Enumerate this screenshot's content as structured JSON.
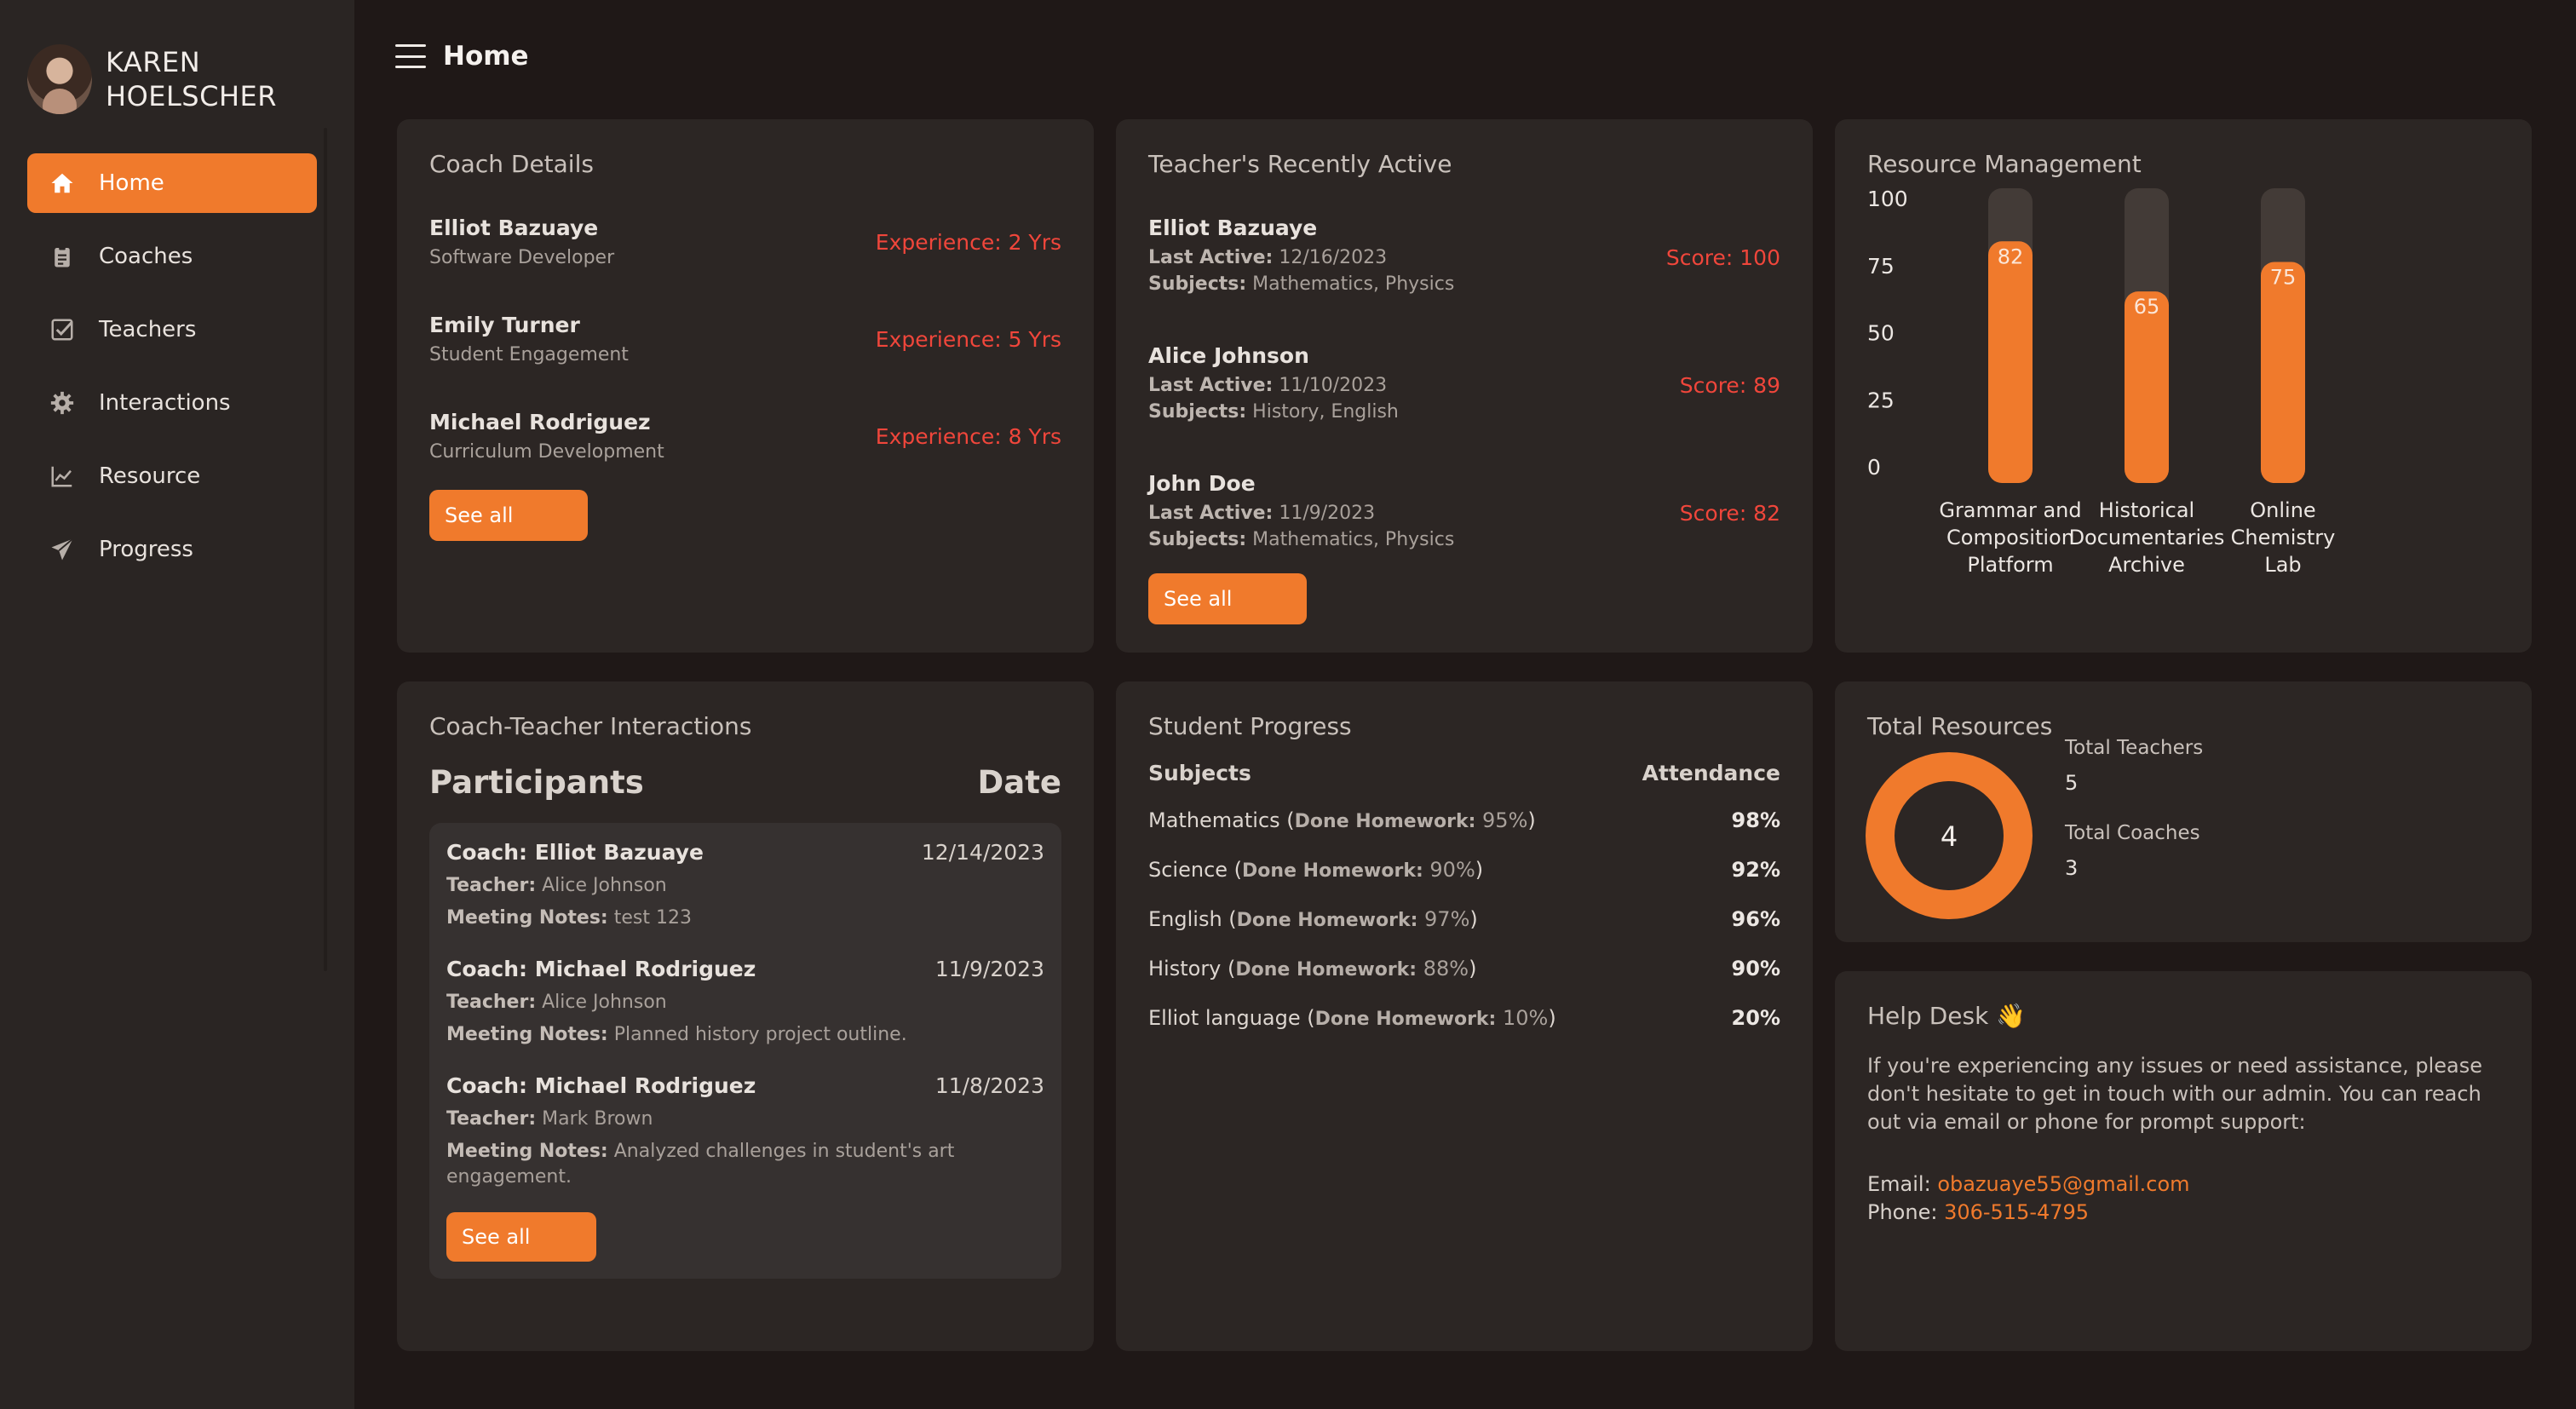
{
  "sidebar": {
    "user_name": "KAREN HOELSCHER",
    "items": [
      {
        "label": "Home",
        "icon": "home-icon"
      },
      {
        "label": "Coaches",
        "icon": "clipboard-icon"
      },
      {
        "label": "Teachers",
        "icon": "checkbox-icon"
      },
      {
        "label": "Interactions",
        "icon": "gear-icon"
      },
      {
        "label": "Resource",
        "icon": "line-chart-icon"
      },
      {
        "label": "Progress",
        "icon": "paper-plane-icon"
      }
    ]
  },
  "header": {
    "title": "Home"
  },
  "coach_details": {
    "title": "Coach Details",
    "coaches": [
      {
        "name": "Elliot Bazuaye",
        "role": "Software Developer",
        "experience": "Experience: 2 Yrs"
      },
      {
        "name": "Emily Turner",
        "role": "Student Engagement",
        "experience": "Experience: 5 Yrs"
      },
      {
        "name": "Michael Rodriguez",
        "role": "Curriculum Development",
        "experience": "Experience: 8 Yrs"
      }
    ],
    "button": "See all"
  },
  "teachers_active": {
    "title": "Teacher's Recently Active",
    "last_active_label": "Last Active:",
    "subjects_label": "Subjects:",
    "teachers": [
      {
        "name": "Elliot Bazuaye",
        "last_active": "12/16/2023",
        "subjects": "Mathematics, Physics",
        "score": "Score: 100"
      },
      {
        "name": "Alice Johnson",
        "last_active": "11/10/2023",
        "subjects": "History, English",
        "score": "Score: 89"
      },
      {
        "name": "John Doe",
        "last_active": "11/9/2023",
        "subjects": "Mathematics, Physics",
        "score": "Score: 82"
      }
    ],
    "button": "See all"
  },
  "resource_management": {
    "title": "Resource Management"
  },
  "chart_data": {
    "type": "bar",
    "categories": [
      "Grammar and Composition Platform",
      "Historical Documentaries Archive",
      "Online Chemistry Lab"
    ],
    "category_lines": [
      [
        "Grammar and",
        "Composition",
        "Platform"
      ],
      [
        "Historical",
        "Documentaries",
        "Archive"
      ],
      [
        "Online",
        "Chemistry",
        "Lab"
      ]
    ],
    "values": [
      82,
      65,
      75
    ],
    "ylim": [
      0,
      100
    ],
    "yticks": [
      100,
      75,
      50,
      25,
      0
    ],
    "bar_color": "#f07a2c",
    "track_color": "#433b37",
    "data_labels": true
  },
  "interactions": {
    "title": "Coach-Teacher Interactions",
    "col_participants": "Participants",
    "col_date": "Date",
    "teacher_label": "Teacher:",
    "notes_label": "Meeting Notes:",
    "items": [
      {
        "coach": "Coach: Elliot Bazuaye",
        "date": "12/14/2023",
        "teacher": "Alice Johnson",
        "notes": "test 123"
      },
      {
        "coach": "Coach: Michael Rodriguez",
        "date": "11/9/2023",
        "teacher": "Alice Johnson",
        "notes": "Planned history project outline."
      },
      {
        "coach": "Coach: Michael Rodriguez",
        "date": "11/8/2023",
        "teacher": "Mark Brown",
        "notes": "Analyzed challenges in student's art engagement."
      }
    ],
    "button": "See all"
  },
  "student_progress": {
    "title": "Student Progress",
    "col_subjects": "Subjects",
    "col_attendance": "Attendance",
    "homework_label": "Done Homework:",
    "rows": [
      {
        "subject": "Mathematics",
        "homework": "95%",
        "attendance": "98%"
      },
      {
        "subject": "Science",
        "homework": "90%",
        "attendance": "92%"
      },
      {
        "subject": "English",
        "homework": "97%",
        "attendance": "96%"
      },
      {
        "subject": "History",
        "homework": "88%",
        "attendance": "90%"
      },
      {
        "subject": "Elliot language",
        "homework": "10%",
        "attendance": "20%"
      }
    ]
  },
  "total_resources": {
    "title": "Total Resources",
    "total": "4",
    "teachers_label": "Total Teachers",
    "teachers_value": "5",
    "coaches_label": "Total Coaches",
    "coaches_value": "3"
  },
  "help_desk": {
    "title": "Help Desk 👋",
    "text": "If you're experiencing any issues or need assistance, please don't hesitate to get in touch with our admin. You can reach out via email or phone for prompt support:",
    "email_label": "Email: ",
    "email": "obazuaye55@gmail.com",
    "phone_label": "Phone: ",
    "phone": "306-515-4795"
  },
  "colors": {
    "accent": "#f07a2c",
    "alert": "#f0463b",
    "background": "#1f1817",
    "card": "#2c2624"
  }
}
